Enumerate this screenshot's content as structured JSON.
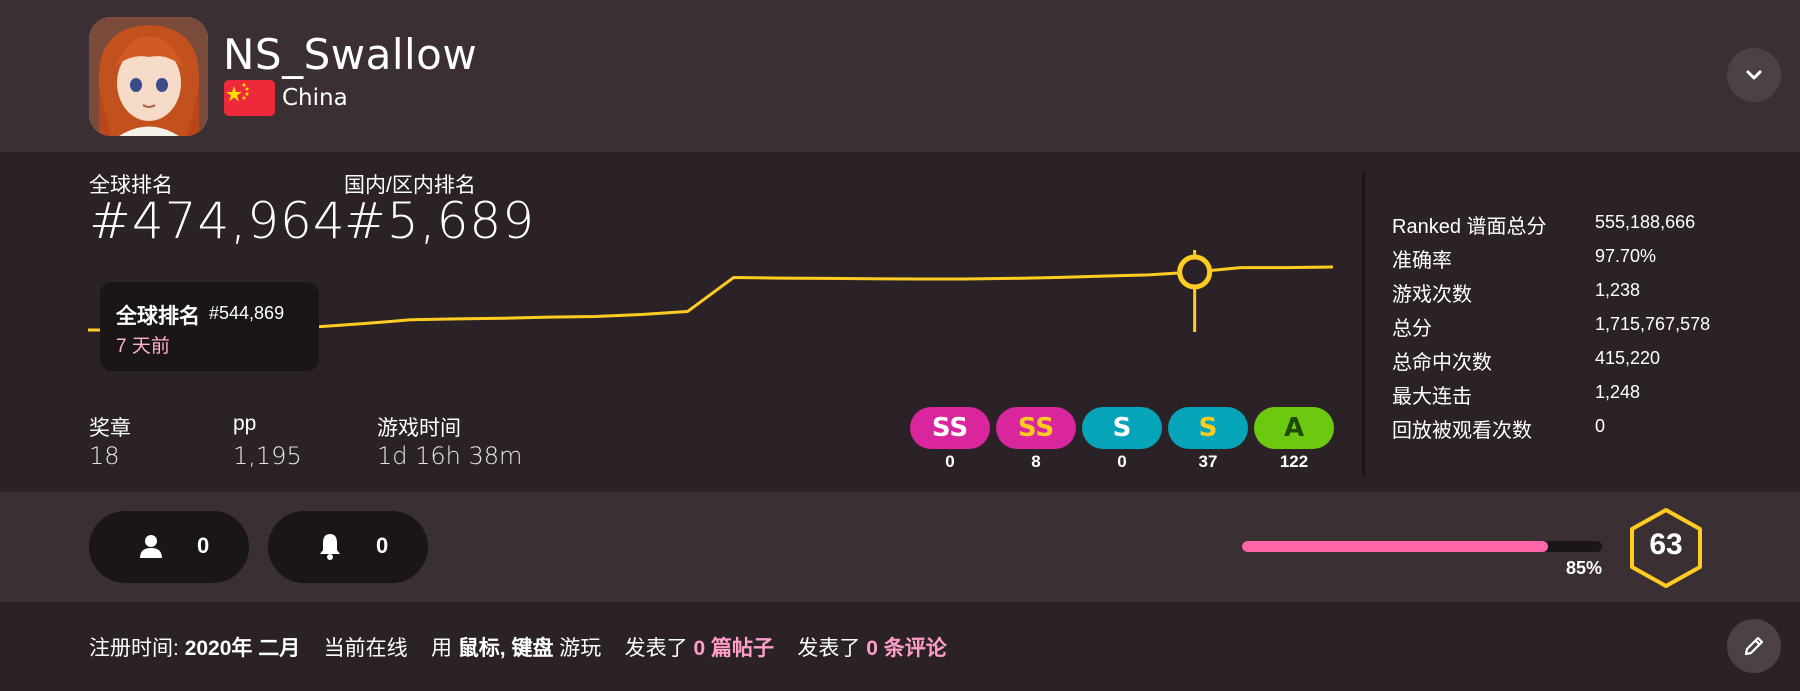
{
  "profile": {
    "username": "NS_Swallow",
    "country": "China",
    "icons": {
      "avatar": "anime-avatar",
      "flag": "china-flag-icon",
      "expand": "chevron-down-icon",
      "edit": "pencil-icon"
    }
  },
  "ranks": {
    "global_label": "全球排名",
    "global_value": "#474,964",
    "country_label": "国内/区内排名",
    "country_value": "#5,689"
  },
  "tooltip": {
    "title": "全球排名",
    "rank": "#544,869",
    "time": "7 天前"
  },
  "chart_data": {
    "type": "line",
    "title": "",
    "series": [
      {
        "values": [
          1,
          1,
          1,
          1,
          1.3,
          2.1,
          3.2,
          4.5,
          4.8,
          5,
          5.4,
          5.6,
          6.3,
          7.3,
          18.9,
          18.7,
          18.6,
          18.5,
          18.4,
          18.4,
          18.6,
          18.9,
          19.4,
          19.8,
          20.8,
          22.3,
          22.3,
          22.5
        ]
      }
    ],
    "highlight_index": 24,
    "direction": "higher line = better (lower) rank"
  },
  "mini_stats": [
    {
      "label": "奖章",
      "value": "18"
    },
    {
      "label": "pp",
      "value": "1,195"
    },
    {
      "label": "游戏时间",
      "value": "1d 16h 38m"
    }
  ],
  "grades": [
    {
      "name": "SS",
      "count": "0",
      "bg": "#d9269d",
      "fg": "#ffffff"
    },
    {
      "name": "SS",
      "count": "8",
      "bg": "#d9269d",
      "fg": "#ffcc22"
    },
    {
      "name": "S",
      "count": "0",
      "bg": "#05a4b8",
      "fg": "#ffffff"
    },
    {
      "name": "S",
      "count": "37",
      "bg": "#05a4b8",
      "fg": "#ffcc22"
    },
    {
      "name": "A",
      "count": "122",
      "bg": "#6dc90f",
      "fg": "#1e4a00"
    }
  ],
  "side_stats": [
    {
      "label": "Ranked 谱面总分",
      "value": "555,188,666"
    },
    {
      "label": "准确率",
      "value": "97.70%"
    },
    {
      "label": "游戏次数",
      "value": "1,238"
    },
    {
      "label": "总分",
      "value": "1,715,767,578"
    },
    {
      "label": "总命中次数",
      "value": "415,220"
    },
    {
      "label": "最大连击",
      "value": "1,248"
    },
    {
      "label": "回放被观看次数",
      "value": "0"
    }
  ],
  "social": {
    "followers": "0",
    "subscribers": "0",
    "icons": {
      "followers": "user-icon",
      "subscribers": "bell-icon"
    }
  },
  "level": {
    "number": "63",
    "progress": 0.85,
    "progress_label": "85%"
  },
  "footer": {
    "joined_label": "注册时间:",
    "joined_value": "2020年 二月",
    "online": "当前在线",
    "play_with_prefix": "用",
    "devices": "鼠标, 键盘",
    "play_with_suffix": "游玩",
    "posted_prefix": "发表了",
    "posts": "0 篇帖子",
    "comments_prefix": "发表了",
    "comments": "0 条评论"
  },
  "colors": {
    "accent": "#ff66aa",
    "chart_line": "#ffcc22",
    "background": "#2a2226",
    "panel": "#3a3034"
  }
}
